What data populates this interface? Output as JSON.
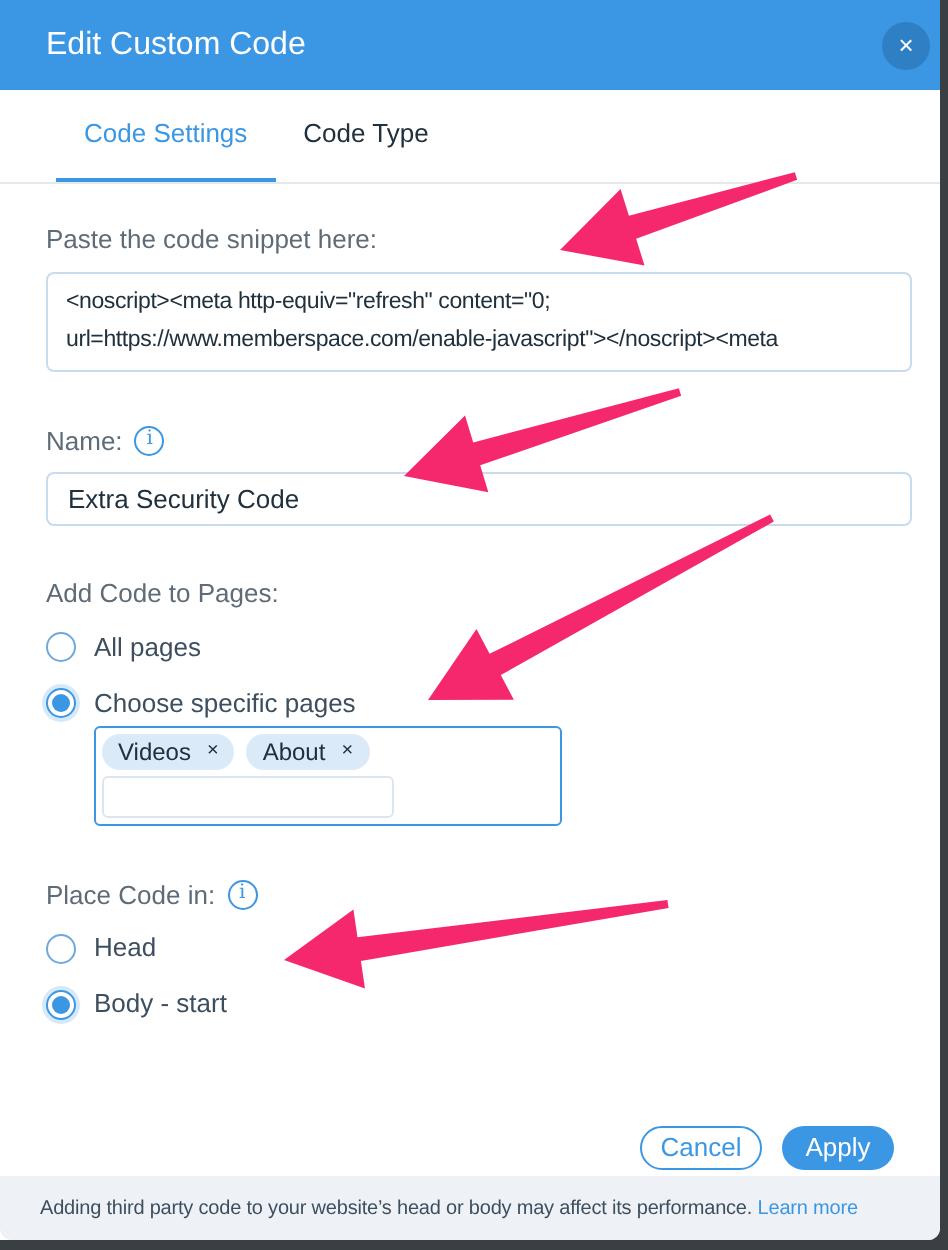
{
  "window": {
    "title": "Edit Custom Code",
    "close": "×"
  },
  "tabs": [
    {
      "label": "Code Settings",
      "selected": true
    },
    {
      "label": "Code Type",
      "selected": false
    }
  ],
  "snippet": {
    "label": "Paste the code snippet here:",
    "value": "<noscript><meta http-equiv=\"refresh\" content=\"0; url=https://www.memberspace.com/enable-javascript\"></noscript><meta"
  },
  "name": {
    "label": "Name:",
    "info": "i",
    "value": "Extra Security Code"
  },
  "pages": {
    "label": "Add Code to Pages:",
    "options": [
      {
        "label": "All pages",
        "selected": false
      },
      {
        "label": "Choose specific pages",
        "selected": true
      }
    ],
    "tags": [
      {
        "label": "Videos",
        "remove": "×"
      },
      {
        "label": "About",
        "remove": "×"
      }
    ]
  },
  "placement": {
    "label": "Place Code in:",
    "info": "i",
    "options": [
      {
        "label": "Head",
        "selected": false
      },
      {
        "label": "Body - start",
        "selected": true
      }
    ]
  },
  "buttons": [
    {
      "label": "Cancel",
      "kind": "secondary"
    },
    {
      "label": "Apply",
      "kind": "primary"
    }
  ],
  "footer": {
    "text": "Adding third party code to your website’s head or body may affect its performance.",
    "link": "Learn more"
  }
}
